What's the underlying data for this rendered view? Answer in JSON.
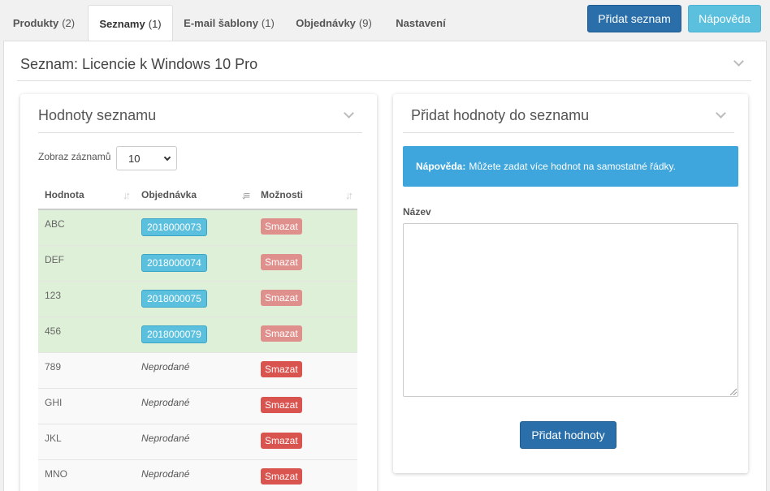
{
  "tabs": [
    {
      "label": "Produkty",
      "count": "(2)"
    },
    {
      "label": "Seznamy",
      "count": "(1)"
    },
    {
      "label": "E-mail šablony",
      "count": "(1)"
    },
    {
      "label": "Objednávky",
      "count": "(9)"
    },
    {
      "label": "Nastavení",
      "count": ""
    }
  ],
  "header_buttons": {
    "add_list": "Přidat seznam",
    "help": "Nápověda"
  },
  "main": {
    "title": "Seznam: Licencie k Windows 10 Pro"
  },
  "values_panel": {
    "title": "Hodnoty seznamu",
    "length_label": "Zobraz záznamů",
    "length_value": "10",
    "columns": [
      "Hodnota",
      "Objednávka",
      "Možnosti"
    ],
    "rows": [
      {
        "value": "ABC",
        "order": "2018000073",
        "sold": true,
        "action": "Smazat"
      },
      {
        "value": "DEF",
        "order": "2018000074",
        "sold": true,
        "action": "Smazat"
      },
      {
        "value": "123",
        "order": "2018000075",
        "sold": true,
        "action": "Smazat"
      },
      {
        "value": "456",
        "order": "2018000079",
        "sold": true,
        "action": "Smazat"
      },
      {
        "value": "789",
        "order": "Neprodané",
        "sold": false,
        "action": "Smazat"
      },
      {
        "value": "GHI",
        "order": "Neprodané",
        "sold": false,
        "action": "Smazat"
      },
      {
        "value": "JKL",
        "order": "Neprodané",
        "sold": false,
        "action": "Smazat"
      },
      {
        "value": "MNO",
        "order": "Neprodané",
        "sold": false,
        "action": "Smazat"
      }
    ]
  },
  "add_panel": {
    "title": "Přidat hodnoty do seznamu",
    "help_bold": "Nápověda:",
    "help_text": "Můžete zadat více hodnot na samostatné řádky.",
    "field_label": "Název",
    "field_value": "",
    "submit": "Přidat hodnoty"
  },
  "colors": {
    "primary": "#2a6faa",
    "info": "#5bc0de",
    "danger": "#d9534f",
    "success_row": "#dff0d8"
  },
  "icons": [
    "chevron-down-icon",
    "sort-icon",
    "sort-desc-icon",
    "select-caret-icon",
    "resize-grip-icon"
  ]
}
